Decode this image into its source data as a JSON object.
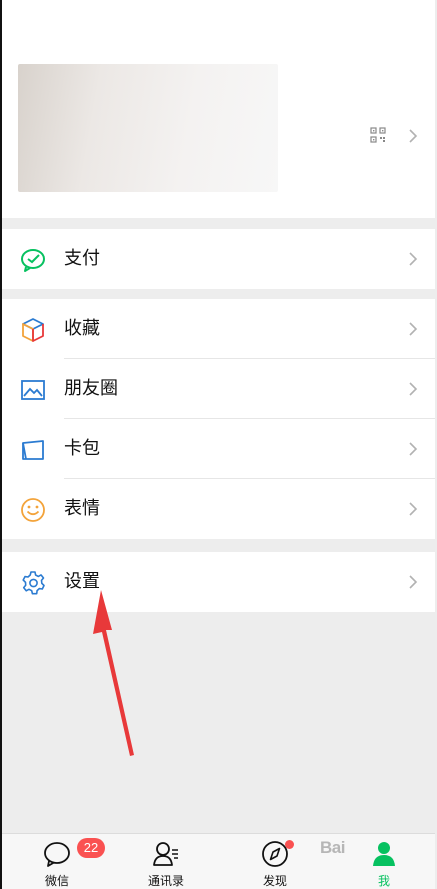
{
  "profile": {
    "qr_icon": "qr-code-icon",
    "chevron_icon": "chevron-right-icon"
  },
  "menu": {
    "pay": {
      "label": "支付",
      "icon": "wechat-pay-icon"
    },
    "favorites": {
      "label": "收藏",
      "icon": "cube-icon"
    },
    "moments": {
      "label": "朋友圈",
      "icon": "photo-icon"
    },
    "cards": {
      "label": "卡包",
      "icon": "card-icon"
    },
    "stickers": {
      "label": "表情",
      "icon": "smiley-icon"
    },
    "settings": {
      "label": "设置",
      "icon": "gear-icon"
    }
  },
  "tabs": [
    {
      "label": "微信",
      "icon": "chat-bubble-icon",
      "badge": "22"
    },
    {
      "label": "通讯录",
      "icon": "contacts-icon"
    },
    {
      "label": "发现",
      "icon": "compass-icon"
    },
    {
      "label": "我",
      "icon": "person-icon",
      "active": true
    }
  ],
  "colors": {
    "accent_green": "#07c160",
    "badge_red": "#fa5151",
    "arrow_red": "#e8393a",
    "icon_blue": "#2b7bd1"
  },
  "watermark": "Bai"
}
